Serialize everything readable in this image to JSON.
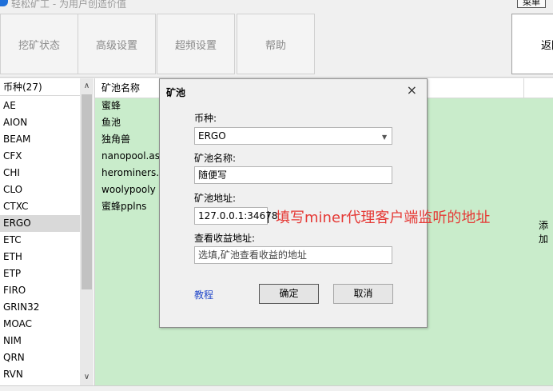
{
  "app": {
    "title": "轻松矿工 - 为用户创造价值",
    "menu_label": "菜单"
  },
  "toolbar": {
    "tabs": [
      "挖矿状态",
      "高级设置",
      "超频设置",
      "帮助"
    ],
    "right_button": "返回"
  },
  "coin_list": {
    "header": "币种(27)",
    "items": [
      "AE",
      "AION",
      "BEAM",
      "CFX",
      "CHI",
      "CLO",
      "CTXC",
      "ERGO",
      "ETC",
      "ETH",
      "ETP",
      "FIRO",
      "GRIN32",
      "MOAC",
      "NIM",
      "QRN",
      "RVN"
    ],
    "selected": "ERGO"
  },
  "pool_list": {
    "header": "矿池名称",
    "items": [
      "蜜蜂",
      "鱼池",
      "独角兽",
      "nanopool.asia",
      "herominers.asia",
      "woolypooly",
      "蜜蜂pplns"
    ],
    "add_label": "添加"
  },
  "dialog": {
    "title": "矿池",
    "close": "×",
    "coin_label": "币种:",
    "coin_value": "ERGO",
    "name_label": "矿池名称:",
    "name_value": "随便写",
    "address_label": "矿池地址:",
    "address_value": "127.0.0.1:34678",
    "profit_label": "查看收益地址:",
    "profit_placeholder": "选填,矿池查看收益的地址",
    "tutorial_link": "教程",
    "ok_button": "确定",
    "cancel_button": "取消"
  },
  "annotation": "填写miner代理客户端监听的地址"
}
